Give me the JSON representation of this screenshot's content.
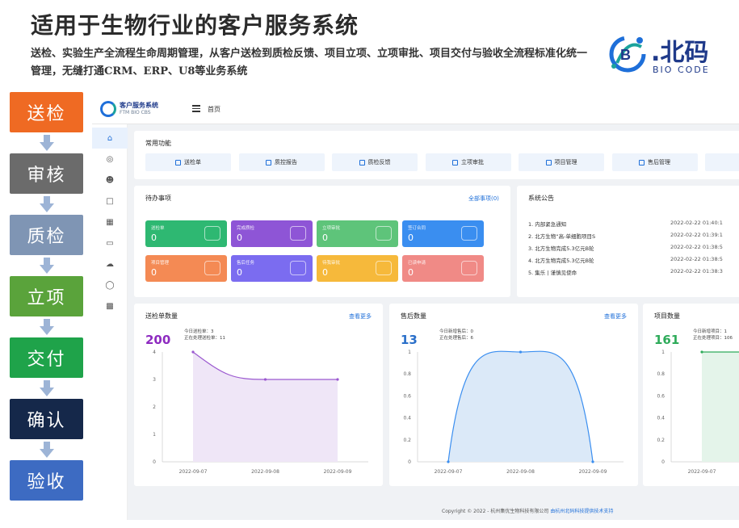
{
  "header": {
    "title": "适用于生物行业的客户服务系统",
    "subtitle": "送检、实验生产全流程生命周期管理，从客户送检到质检反馈、项目立项、立项审批、项目交付与验收全流程标准化统一管理，无缝打通CRM、ERP、U8等业务系统"
  },
  "logo": {
    "main": ".北码",
    "sub": "BIO CODE"
  },
  "flow": {
    "steps": [
      {
        "label": "送检",
        "color": "#ef6a23"
      },
      {
        "label": "审核",
        "color": "#6b6b6b"
      },
      {
        "label": "质检",
        "color": "#7f95b4"
      },
      {
        "label": "立项",
        "color": "#5aa33b"
      },
      {
        "label": "交付",
        "color": "#1fa34a"
      },
      {
        "label": "确认",
        "color": "#15284a"
      },
      {
        "label": "验收",
        "color": "#3d6bc2"
      }
    ],
    "arrow_color": "#9db4d6"
  },
  "app": {
    "logo_title": "客户服务系统",
    "logo_sub": "FTM BIO CBS",
    "breadcrumb": "首页",
    "quick": {
      "title": "常用功能",
      "buttons": [
        "送检单",
        "质控报告",
        "质检反馈",
        "立项审批",
        "项目管理",
        "售后管理"
      ]
    },
    "todo": {
      "title": "待办事项",
      "link": "全部事项(0)",
      "cards": [
        {
          "label": "送检单",
          "value": "0",
          "color": "#2eb872"
        },
        {
          "label": "完成质检",
          "value": "0",
          "color": "#8e55d6"
        },
        {
          "label": "立项审批",
          "value": "0",
          "color": "#5ec47a"
        },
        {
          "label": "签订合同",
          "value": "0",
          "color": "#3a8ef0"
        },
        {
          "label": "项目管理",
          "value": "0",
          "color": "#f48a54"
        },
        {
          "label": "售后任务",
          "value": "0",
          "color": "#7b6cf0"
        },
        {
          "label": "待我审批",
          "value": "0",
          "color": "#f6b93b"
        },
        {
          "label": "已读申请",
          "value": "0",
          "color": "#f08a86"
        }
      ]
    },
    "notice": {
      "title": "系统公告",
      "items": [
        {
          "text": "1. 内部紧急通知",
          "date": "2022-02-22 01:40:1"
        },
        {
          "text": "2. 北方生物“高-单细胞项目S",
          "date": "2022-02-22 01:39:1"
        },
        {
          "text": "3. 北方生物完成5.3亿元B轮",
          "date": "2022-02-22 01:38:5"
        },
        {
          "text": "4. 北方生物完成5.3亿元B轮",
          "date": "2022-02-22 01:38:5"
        },
        {
          "text": "5. 集乐 | 谨慎见使命",
          "date": "2022-02-22 01:38:3"
        }
      ]
    },
    "charts": [
      {
        "title": "送检单数量",
        "link": "查看更多",
        "total": "200",
        "total_color": "#8e2bc0",
        "stat1": "今日送检单：3",
        "stat2": "正在处理送检单：11",
        "color": "#9b59d0",
        "fill": "#efe6f7"
      },
      {
        "title": "售后数量",
        "link": "查看更多",
        "total": "13",
        "total_color": "#2a6fc9",
        "stat1": "今日新增售后：0",
        "stat2": "正在处理售后：6",
        "color": "#3a8ef0",
        "fill": "#dbe9f8"
      },
      {
        "title": "项目数量",
        "link": "",
        "total": "161",
        "total_color": "#2eab5a",
        "stat1": "今日新增项目：1",
        "stat2": "正在处理项目：106",
        "color": "#2eab5a",
        "fill": "#e4f4ea"
      }
    ],
    "footer": {
      "text": "Copyright © 2022 - 杭州集优生物科技有限公司",
      "link": "由杭州北码科技提供技术支持"
    }
  },
  "chart_data": [
    {
      "type": "area",
      "title": "送检单数量",
      "x": [
        "2022-09-07",
        "2022-09-08",
        "2022-09-09"
      ],
      "series": [
        {
          "values": [
            4,
            3,
            3
          ]
        }
      ],
      "ylim": [
        0,
        4
      ],
      "yticks": [
        0,
        1,
        2,
        3,
        4
      ],
      "grid": false
    },
    {
      "type": "area",
      "title": "售后数量",
      "x": [
        "2022-09-07",
        "2022-09-08",
        "2022-09-09"
      ],
      "series": [
        {
          "values": [
            0,
            1,
            0
          ]
        }
      ],
      "ylim": [
        0,
        1
      ],
      "yticks": [
        0,
        0.2,
        0.4,
        0.6,
        0.8,
        1
      ],
      "grid": false
    },
    {
      "type": "area",
      "title": "项目数量",
      "x": [
        "2022-09-07"
      ],
      "series": [
        {
          "values": [
            1
          ]
        }
      ],
      "ylim": [
        0,
        1
      ],
      "yticks": [
        0,
        0.2,
        0.4,
        0.6,
        0.8,
        1
      ],
      "grid": false
    }
  ]
}
